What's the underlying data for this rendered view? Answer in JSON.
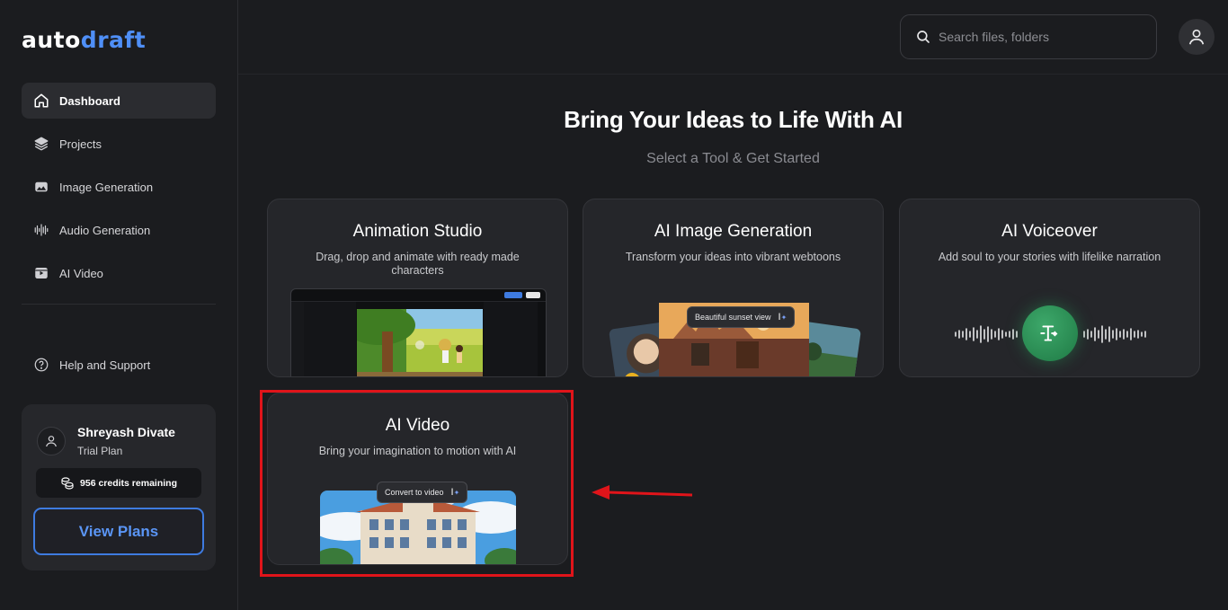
{
  "brand": {
    "part1": "auto",
    "part2": "draft"
  },
  "sidebar": {
    "items": [
      {
        "label": "Dashboard",
        "icon": "home-icon",
        "active": true
      },
      {
        "label": "Projects",
        "icon": "layers-icon"
      },
      {
        "label": "Image Generation",
        "icon": "image-icon"
      },
      {
        "label": "Audio Generation",
        "icon": "waveform-icon"
      },
      {
        "label": "AI Video",
        "icon": "video-icon"
      }
    ],
    "help": {
      "label": "Help and Support",
      "icon": "help-icon"
    }
  },
  "user": {
    "name": "Shreyash Divate",
    "plan": "Trial Plan",
    "credits": "956 credits remaining",
    "view_plans": "View Plans"
  },
  "search": {
    "placeholder": "Search files, folders"
  },
  "main": {
    "title": "Bring Your Ideas to Life With AI",
    "subtitle": "Select a Tool & Get Started",
    "cards": [
      {
        "title": "Animation Studio",
        "description": "Drag, drop and animate with ready made characters"
      },
      {
        "title": "AI Image Generation",
        "description": "Transform your ideas into vibrant webtoons",
        "tooltip": "Beautiful sunset view"
      },
      {
        "title": "AI Voiceover",
        "description": "Add soul to your stories with lifelike narration"
      },
      {
        "title": "AI Video",
        "description": "Bring your imagination to motion with AI",
        "tooltip": "Convert to video"
      }
    ]
  },
  "colors": {
    "accent": "#4f8ff7",
    "highlight": "#e0141a",
    "voice_green": "#2e9a5c"
  }
}
